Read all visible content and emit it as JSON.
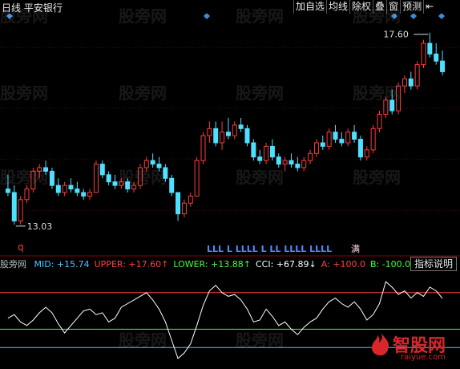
{
  "window": {
    "title": "日线 平安银行"
  },
  "toolbar": {
    "items": [
      "加自选",
      "均线",
      "除权",
      "叠",
      "窗",
      "预测",
      "⇤"
    ]
  },
  "price_chart": {
    "high_label": "17.60",
    "low_label": "13.03",
    "marker_q": "q",
    "signal_text": "LLL  L  LLLL  L   LL   LLLL   LLLL",
    "signal_end": "满",
    "candles": [
      [
        14.1,
        14.5,
        13.9,
        14.0
      ],
      [
        14.0,
        14.2,
        13.1,
        13.2
      ],
      [
        13.2,
        13.9,
        13.1,
        13.8
      ],
      [
        13.8,
        14.2,
        13.7,
        14.1
      ],
      [
        14.1,
        14.7,
        14.0,
        14.6
      ],
      [
        14.6,
        14.8,
        14.4,
        14.7
      ],
      [
        14.7,
        14.9,
        14.5,
        14.6
      ],
      [
        14.6,
        14.7,
        14.1,
        14.2
      ],
      [
        14.2,
        14.4,
        13.9,
        14.0
      ],
      [
        14.0,
        14.3,
        13.9,
        14.2
      ],
      [
        14.2,
        14.4,
        14.0,
        14.1
      ],
      [
        14.1,
        14.3,
        13.9,
        14.0
      ],
      [
        14.0,
        14.1,
        13.8,
        13.9
      ],
      [
        13.9,
        14.1,
        13.8,
        14.0
      ],
      [
        14.0,
        14.9,
        14.0,
        14.8
      ],
      [
        14.8,
        14.9,
        14.4,
        14.5
      ],
      [
        14.5,
        14.6,
        14.2,
        14.3
      ],
      [
        14.3,
        14.5,
        14.1,
        14.2
      ],
      [
        14.2,
        14.4,
        14.1,
        14.3
      ],
      [
        14.3,
        14.4,
        14.0,
        14.1
      ],
      [
        14.1,
        14.3,
        14.0,
        14.2
      ],
      [
        14.2,
        14.8,
        14.1,
        14.7
      ],
      [
        14.7,
        15.0,
        14.6,
        14.9
      ],
      [
        14.9,
        15.1,
        14.7,
        14.8
      ],
      [
        14.8,
        15.0,
        14.6,
        14.7
      ],
      [
        14.7,
        14.8,
        14.3,
        14.4
      ],
      [
        14.4,
        14.5,
        13.9,
        14.0
      ],
      [
        14.0,
        14.0,
        13.2,
        13.4
      ],
      [
        13.4,
        13.8,
        13.3,
        13.7
      ],
      [
        13.7,
        14.0,
        13.6,
        13.9
      ],
      [
        13.9,
        15.0,
        13.9,
        14.9
      ],
      [
        14.9,
        15.7,
        14.8,
        15.6
      ],
      [
        15.6,
        16.0,
        15.4,
        15.8
      ],
      [
        15.8,
        16.0,
        15.3,
        15.4
      ],
      [
        15.4,
        16.0,
        15.2,
        15.7
      ],
      [
        15.7,
        16.1,
        15.5,
        15.6
      ],
      [
        15.6,
        16.0,
        15.5,
        15.9
      ],
      [
        15.9,
        16.1,
        15.7,
        15.8
      ],
      [
        15.8,
        15.9,
        15.3,
        15.4
      ],
      [
        15.4,
        15.5,
        14.9,
        15.0
      ],
      [
        15.0,
        15.2,
        14.8,
        14.9
      ],
      [
        14.9,
        15.4,
        14.8,
        15.3
      ],
      [
        15.3,
        15.5,
        14.9,
        15.0
      ],
      [
        15.0,
        15.1,
        14.7,
        14.8
      ],
      [
        14.8,
        15.0,
        14.6,
        14.9
      ],
      [
        14.9,
        15.1,
        14.7,
        14.8
      ],
      [
        14.8,
        15.0,
        14.6,
        14.7
      ],
      [
        14.7,
        15.0,
        14.6,
        14.9
      ],
      [
        14.9,
        15.2,
        14.8,
        15.1
      ],
      [
        15.1,
        15.5,
        15.0,
        15.4
      ],
      [
        15.4,
        15.6,
        15.2,
        15.3
      ],
      [
        15.3,
        15.8,
        15.2,
        15.7
      ],
      [
        15.7,
        15.9,
        15.4,
        15.5
      ],
      [
        15.5,
        15.7,
        15.3,
        15.4
      ],
      [
        15.4,
        15.8,
        15.3,
        15.7
      ],
      [
        15.7,
        15.9,
        15.4,
        15.5
      ],
      [
        15.5,
        15.6,
        14.9,
        15.0
      ],
      [
        15.0,
        15.3,
        14.9,
        15.2
      ],
      [
        15.2,
        15.9,
        15.1,
        15.8
      ],
      [
        15.8,
        16.3,
        15.7,
        16.2
      ],
      [
        16.2,
        16.7,
        16.1,
        16.6
      ],
      [
        16.6,
        16.9,
        16.2,
        16.3
      ],
      [
        16.3,
        17.1,
        16.2,
        17.0
      ],
      [
        17.0,
        17.3,
        16.8,
        17.2
      ],
      [
        17.2,
        17.4,
        16.9,
        17.0
      ],
      [
        17.0,
        17.7,
        16.9,
        17.6
      ],
      [
        17.6,
        18.3,
        17.5,
        18.2
      ],
      [
        18.2,
        18.5,
        17.8,
        17.9
      ],
      [
        17.9,
        18.2,
        17.6,
        17.7
      ],
      [
        17.7,
        18.0,
        17.3,
        17.4
      ]
    ]
  },
  "indicator": {
    "watermark_prefix": "股旁网",
    "items": [
      {
        "label": "MID:",
        "value": "+15.74",
        "color": "#4fc3ff"
      },
      {
        "label": "UPPER:",
        "value": "+17.60↑",
        "color": "#ff4040"
      },
      {
        "label": "LOWER:",
        "value": "+13.88↑",
        "color": "#40ff40"
      },
      {
        "label": "CCI:",
        "value": "+67.89↓",
        "color": "#ffffff"
      },
      {
        "label": "A:",
        "value": "+100.0",
        "color": "#ff4040"
      },
      {
        "label": "B:",
        "value": "-100.0",
        "color": "#40ff40"
      }
    ],
    "explain_button": "指标说明",
    "cci_series": [
      -40,
      -20,
      -60,
      -80,
      -50,
      -10,
      20,
      -10,
      -70,
      -120,
      -80,
      -40,
      0,
      10,
      -20,
      -10,
      -60,
      -40,
      20,
      40,
      60,
      80,
      100,
      60,
      10,
      -60,
      -160,
      -260,
      -230,
      -180,
      -80,
      30,
      110,
      140,
      100,
      80,
      90,
      60,
      10,
      -60,
      -50,
      10,
      -30,
      -80,
      -60,
      -100,
      -130,
      -90,
      -60,
      -40,
      10,
      50,
      70,
      40,
      20,
      50,
      10,
      -50,
      -20,
      40,
      160,
      130,
      90,
      110,
      70,
      100,
      80,
      130,
      110,
      67.89
    ]
  },
  "watermarks": [
    "股旁网",
    "股旁网",
    "股旁网",
    "股旁网",
    "股旁网",
    "股旁网",
    "股旁网",
    "股旁网",
    "股旁网",
    "股旁网",
    "股旁网",
    "股旁网",
    "股旁网",
    "股旁网"
  ],
  "logo": {
    "brand": "智股网",
    "url": "raiyue.com"
  },
  "colors": {
    "up": "#ff3b3b",
    "down": "#4fe0ff",
    "mid": "#4fc3ff",
    "upper": "#ff4040",
    "lower": "#40ff40",
    "grid": "#5a0000",
    "cci_line": "#ffffff",
    "signal": "#4f8dff"
  }
}
